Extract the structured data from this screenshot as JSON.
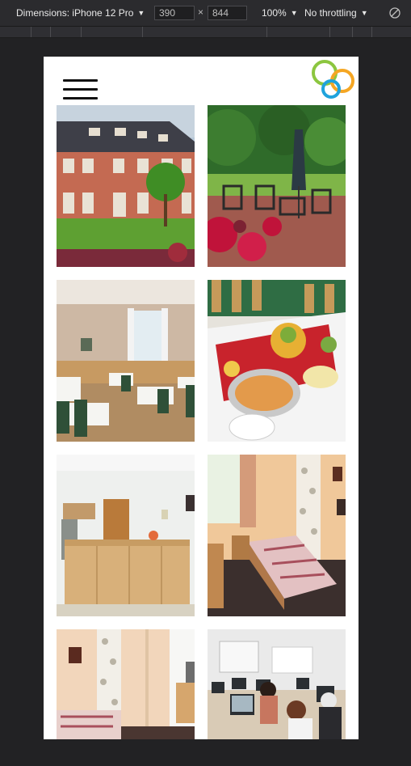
{
  "devtools": {
    "device_label": "Dimensions: iPhone 12 Pro",
    "width_value": "390",
    "height_value": "844",
    "times_symbol": "×",
    "zoom_label": "100%",
    "throttle_label": "No throttling",
    "caret_icon": "triangle-down"
  },
  "site": {
    "menu_icon": "hamburger-menu",
    "logo_icon": "three-overlapping-rings",
    "colors": {
      "ring_green": "#8cc63f",
      "ring_orange": "#f5a623",
      "ring_blue": "#1fa3dc"
    }
  },
  "gallery": {
    "photos": [
      {
        "subject": "hotel-building-exterior"
      },
      {
        "subject": "garden-terrace-with-umbrella"
      },
      {
        "subject": "dining-room"
      },
      {
        "subject": "buffet-table"
      },
      {
        "subject": "reception-desk"
      },
      {
        "subject": "bedroom-single-bed"
      },
      {
        "subject": "bedroom-wallpaper"
      },
      {
        "subject": "computer-classroom"
      }
    ]
  }
}
